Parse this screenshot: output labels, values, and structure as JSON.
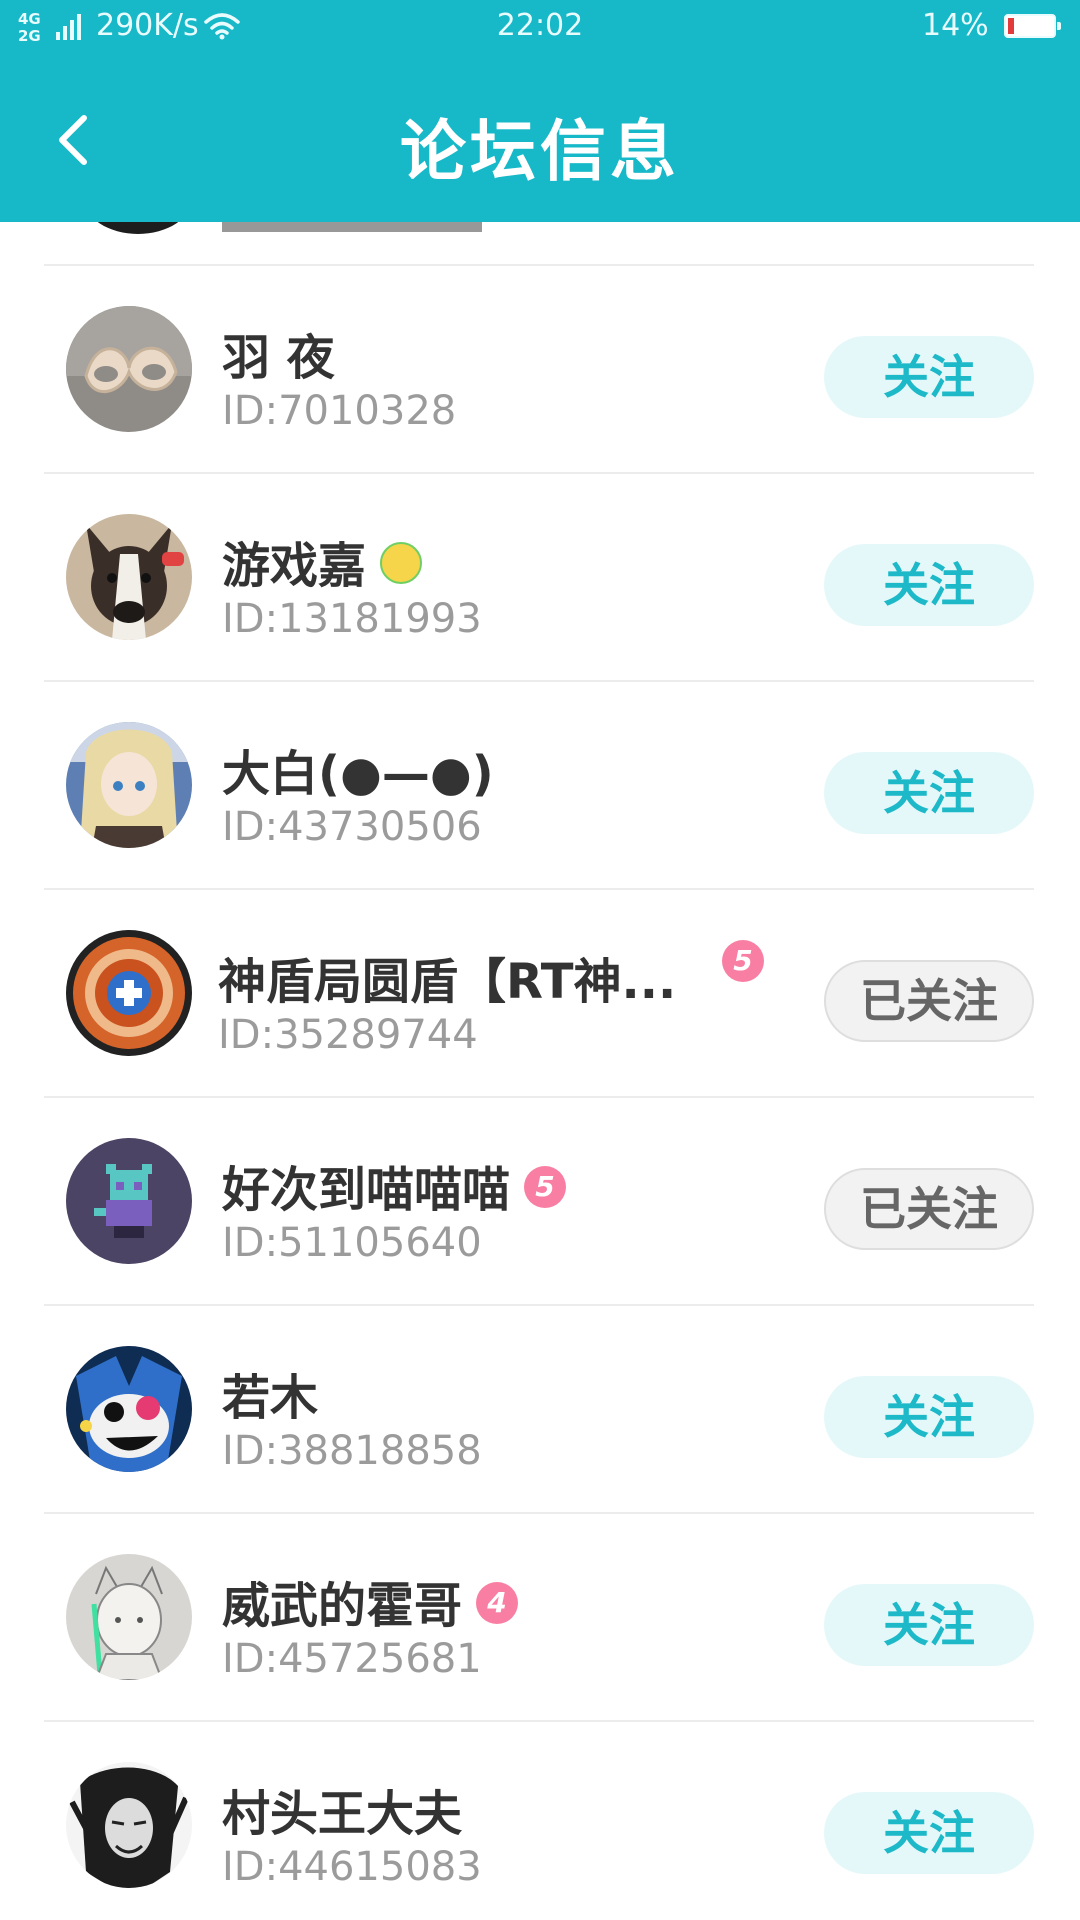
{
  "status_bar": {
    "network_top": "4G",
    "network_bottom": "2G",
    "speed": "290K/s",
    "time": "22:02",
    "battery": "14%",
    "battery_level": 0.14
  },
  "header": {
    "title": "论坛信息",
    "back_icon": "chevron-left-icon"
  },
  "users": [
    {
      "name": "羽 夜",
      "id": "ID:7010328",
      "button": "关注",
      "followed": false
    },
    {
      "name": "游戏嘉",
      "id": "ID:13181993",
      "button": "关注",
      "followed": false
    },
    {
      "name": "大白(●—●)",
      "id": "ID:43730506",
      "button": "关注",
      "followed": false
    },
    {
      "name": "神盾局圆盾【RT神...",
      "id": "ID:35289744",
      "button": "已关注",
      "followed": true,
      "level": "5"
    },
    {
      "name": "好次到喵喵喵",
      "id": "ID:51105640",
      "button": "已关注",
      "followed": true,
      "level": "5"
    },
    {
      "name": "若木",
      "id": "ID:38818858",
      "button": "关注",
      "followed": false
    },
    {
      "name": "威武的霍哥",
      "id": "ID:45725681",
      "button": "关注",
      "followed": false,
      "level": "4"
    },
    {
      "name": "村头王大夫",
      "id": "ID:44615083",
      "button": "关注",
      "followed": false
    }
  ],
  "colors": {
    "accent": "#17b8c8",
    "follow_text": "#1db9c8",
    "follow_bg": "#e5f8f9",
    "level_badge": "#f87fa3"
  }
}
